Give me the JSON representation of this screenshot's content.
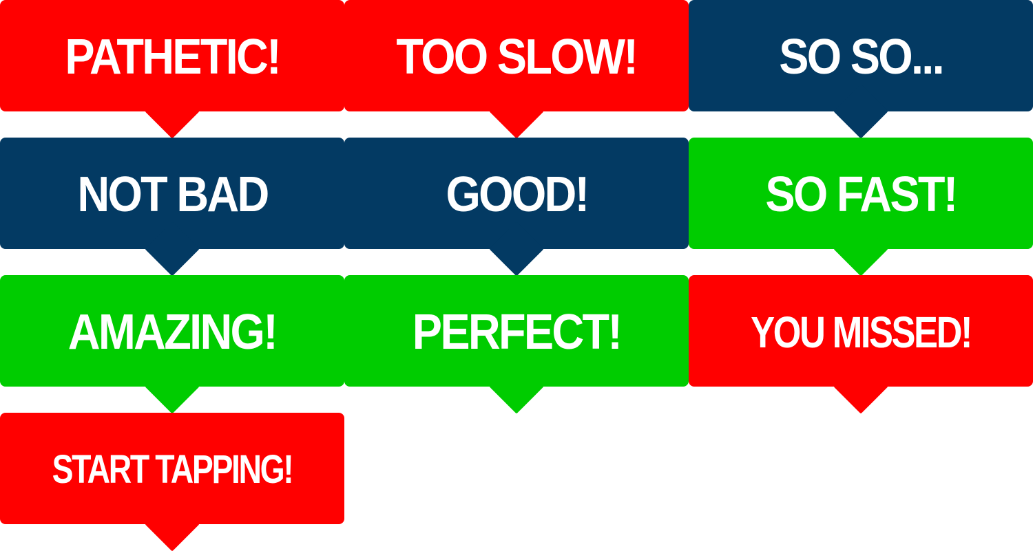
{
  "bubbles": [
    {
      "label": "PATHETIC!",
      "color": "#ff0000"
    },
    {
      "label": "TOO SLOW!",
      "color": "#ff0000"
    },
    {
      "label": "SO SO...",
      "color": "#033a63"
    },
    {
      "label": "NOT BAD",
      "color": "#033a63"
    },
    {
      "label": "GOOD!",
      "color": "#033a63"
    },
    {
      "label": "SO FAST!",
      "color": "#00cc00"
    },
    {
      "label": "AMAZING!",
      "color": "#00cc00"
    },
    {
      "label": "PERFECT!",
      "color": "#00cc00"
    },
    {
      "label": "YOU MISSED!",
      "color": "#ff0000"
    },
    {
      "label": "START TAPPING!",
      "color": "#ff0000"
    }
  ]
}
